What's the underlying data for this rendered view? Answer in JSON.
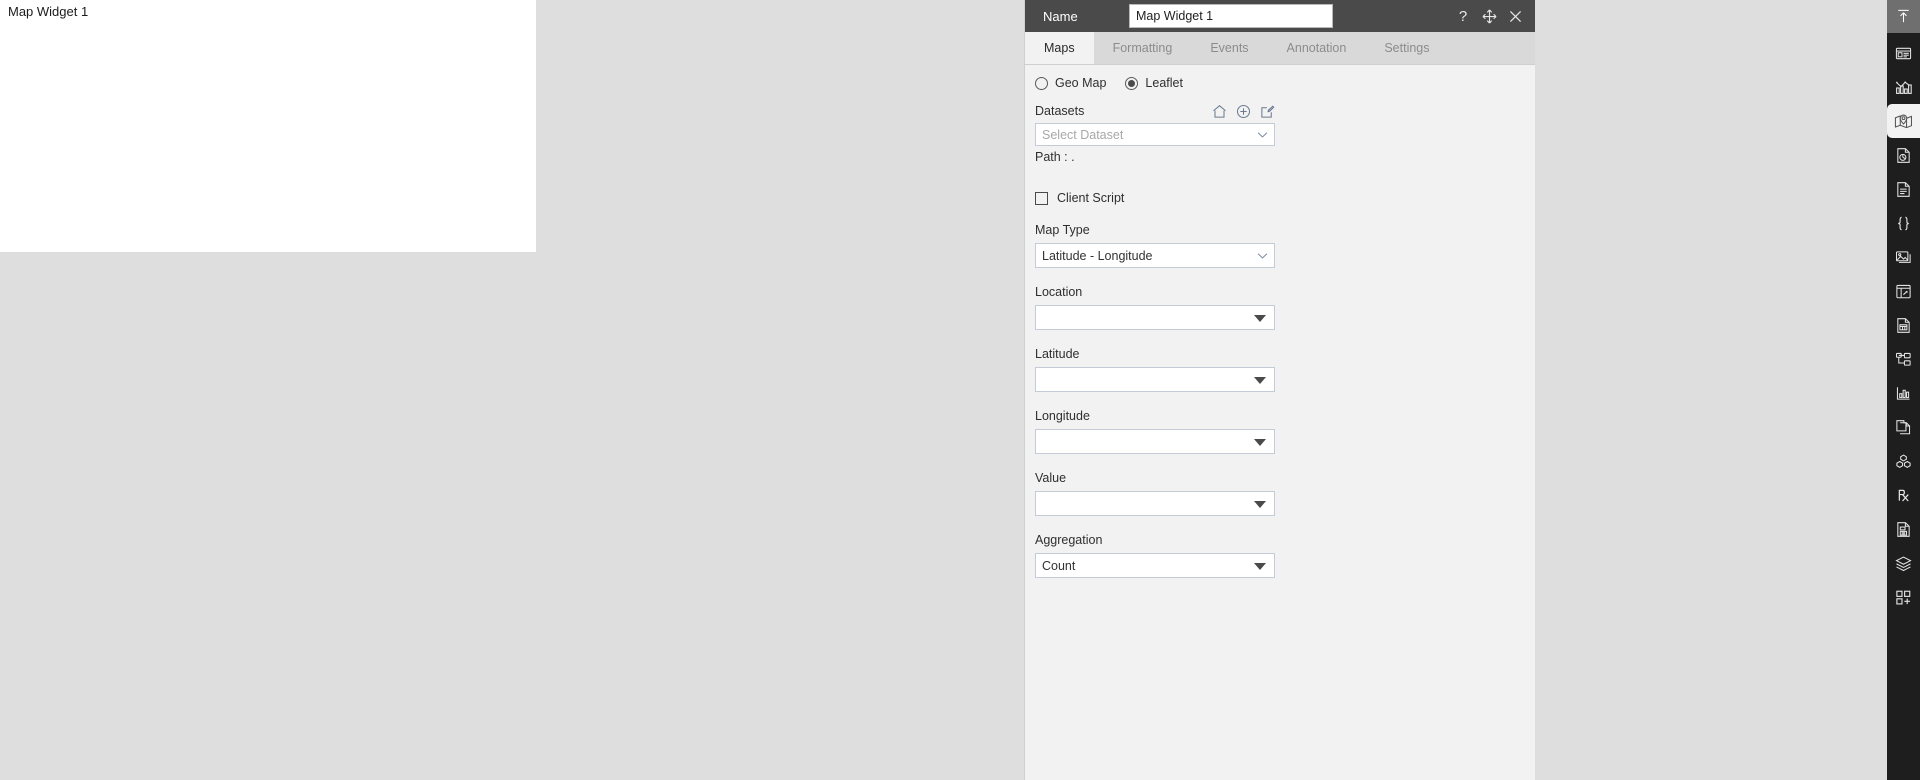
{
  "canvas": {
    "widget_title": "Map Widget 1"
  },
  "panel": {
    "header": {
      "name_label": "Name",
      "name_value": "Map Widget 1",
      "help_icon": "question-mark-icon",
      "move_icon": "move-arrows-icon",
      "close_icon": "close-x-icon"
    },
    "tabs": [
      {
        "label": "Maps",
        "active": true
      },
      {
        "label": "Formatting",
        "active": false
      },
      {
        "label": "Events",
        "active": false
      },
      {
        "label": "Annotation",
        "active": false
      },
      {
        "label": "Settings",
        "active": false
      }
    ],
    "map_engine": {
      "options": [
        {
          "label": "Geo Map",
          "selected": false
        },
        {
          "label": "Leaflet",
          "selected": true
        }
      ]
    },
    "datasets": {
      "label": "Datasets",
      "icons": [
        "home-icon",
        "add-circle-icon",
        "edit-pencil-icon"
      ],
      "select_placeholder": "Select Dataset",
      "select_value": "",
      "path_label": "Path :  ."
    },
    "client_script": {
      "label": "Client Script",
      "checked": false
    },
    "map_type": {
      "label": "Map Type",
      "value": "Latitude - Longitude"
    },
    "location": {
      "label": "Location",
      "value": ""
    },
    "latitude": {
      "label": "Latitude",
      "value": ""
    },
    "longitude": {
      "label": "Longitude",
      "value": ""
    },
    "value_field": {
      "label": "Value",
      "value": ""
    },
    "aggregation": {
      "label": "Aggregation",
      "value": "Count"
    }
  },
  "icon_rail": {
    "items": [
      {
        "name": "upload-arrow-icon",
        "state": "top-active"
      },
      {
        "name": "dashboard-layout-icon",
        "state": "normal"
      },
      {
        "name": "chart-bars-icon",
        "state": "normal"
      },
      {
        "name": "map-pin-icon",
        "state": "selected"
      },
      {
        "name": "pie-document-icon",
        "state": "normal"
      },
      {
        "name": "text-document-icon",
        "state": "normal"
      },
      {
        "name": "curly-braces-icon",
        "state": "normal"
      },
      {
        "name": "image-icon",
        "state": "normal"
      },
      {
        "name": "table-layout-icon",
        "state": "normal"
      },
      {
        "name": "document-list-icon",
        "state": "normal"
      },
      {
        "name": "tree-folder-icon",
        "state": "normal"
      },
      {
        "name": "chart-axis-icon",
        "state": "normal"
      },
      {
        "name": "copy-document-icon",
        "state": "normal"
      },
      {
        "name": "cubes-icon",
        "state": "normal"
      },
      {
        "name": "prescription-rx-icon",
        "state": "normal"
      },
      {
        "name": "document-save-icon",
        "state": "normal"
      },
      {
        "name": "layers-stack-icon",
        "state": "normal"
      },
      {
        "name": "add-grid-icon",
        "state": "normal"
      }
    ]
  },
  "colors": {
    "header_bar": "#4a4a4a",
    "panel_bg": "#f2f2f2",
    "tab_bar": "#d9d9d9",
    "canvas_bg": "#dedede",
    "rail_bg": "#1e1e1e",
    "accent_icon": "#6b7a90"
  }
}
